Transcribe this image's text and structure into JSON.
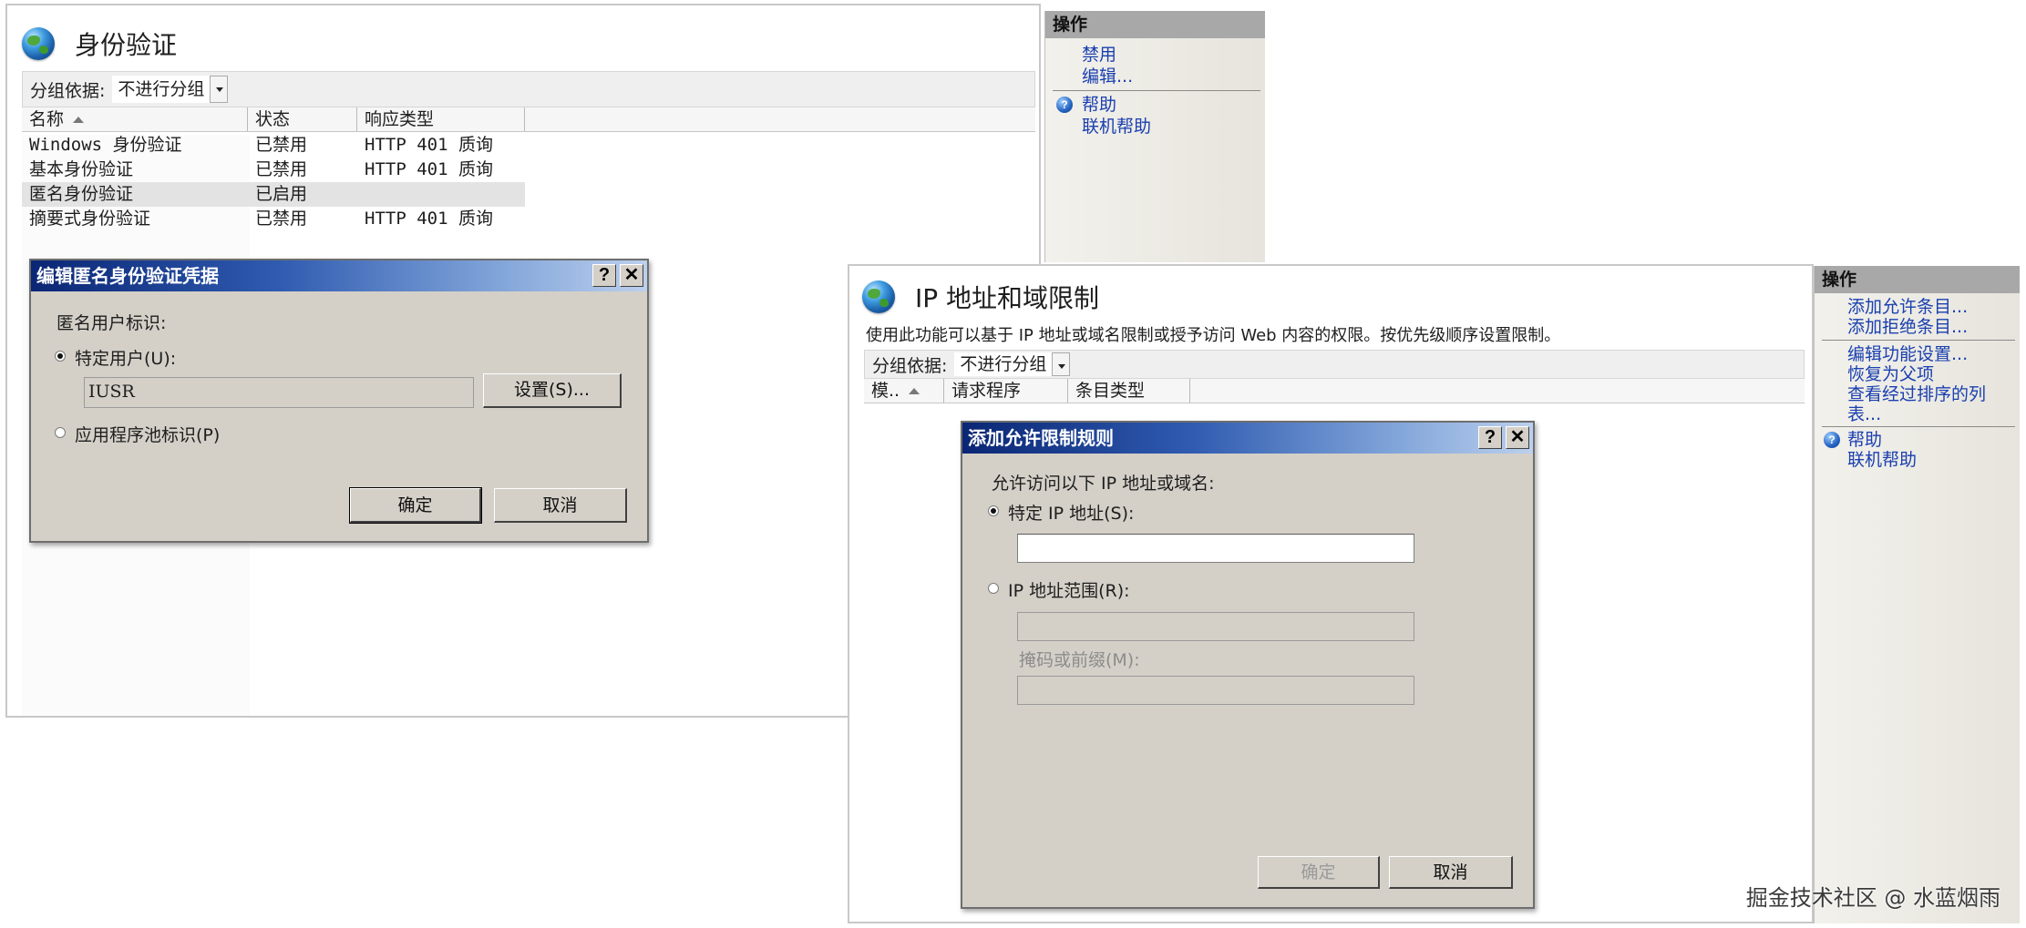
{
  "auth_window": {
    "title": "身份验证",
    "group_by_label": "分组依据:",
    "group_by_value": "不进行分组",
    "columns": [
      "名称",
      "状态",
      "响应类型"
    ],
    "rows": [
      {
        "name": "Windows 身份验证",
        "status": "已禁用",
        "response": "HTTP 401 质询"
      },
      {
        "name": "基本身份验证",
        "status": "已禁用",
        "response": "HTTP 401 质询"
      },
      {
        "name": "匿名身份验证",
        "status": "已启用",
        "response": ""
      },
      {
        "name": "摘要式身份验证",
        "status": "已禁用",
        "response": "HTTP 401 质询"
      }
    ],
    "actions": {
      "header": "操作",
      "items": [
        "禁用",
        "编辑...",
        "帮助",
        "联机帮助"
      ]
    },
    "dialog": {
      "title": "编辑匿名身份验证凭据",
      "help_btn": "?",
      "close_btn": "✕",
      "group_label": "匿名用户标识:",
      "opt_specific_user": "特定用户(U):",
      "user_value": "IUSR",
      "set_button": "设置(S)...",
      "opt_app_pool": "应用程序池标识(P)",
      "ok": "确定",
      "cancel": "取消"
    }
  },
  "ip_window": {
    "title": "IP 地址和域限制",
    "description": "使用此功能可以基于 IP 地址或域名限制或授予访问 Web 内容的权限。按优先级顺序设置限制。",
    "group_by_label": "分组依据:",
    "group_by_value": "不进行分组",
    "columns": [
      "模..",
      "请求程序",
      "条目类型"
    ],
    "actions": {
      "header": "操作",
      "items": [
        "添加允许条目...",
        "添加拒绝条目...",
        "编辑功能设置...",
        "恢复为父项",
        "查看经过排序的列",
        "表...",
        "帮助",
        "联机帮助"
      ]
    },
    "dialog": {
      "title": "添加允许限制规则",
      "help_btn": "?",
      "close_btn": "✕",
      "prompt": "允许访问以下 IP 地址或域名:",
      "opt_specific_ip": "特定 IP 地址(S):",
      "opt_ip_range": "IP 地址范围(R):",
      "mask_label": "掩码或前缀(M):",
      "ok": "确定",
      "cancel": "取消"
    }
  },
  "watermark": "掘金技术社区 @ 水蓝烟雨"
}
